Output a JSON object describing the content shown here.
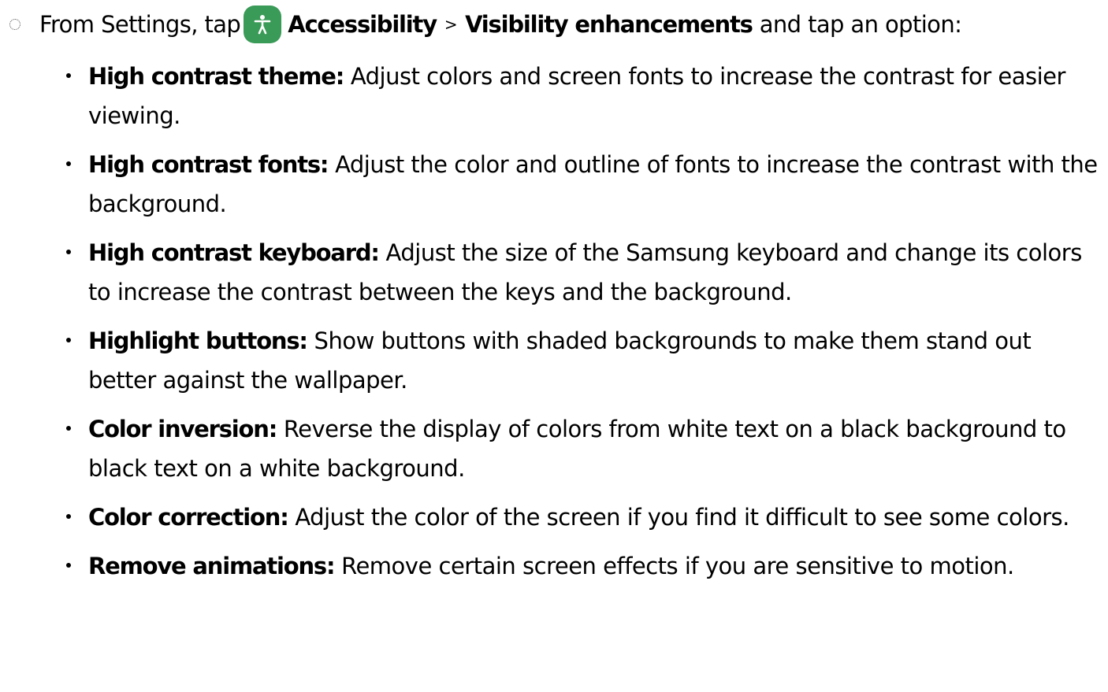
{
  "step": {
    "prefix": "From Settings, tap",
    "icon": "accessibility-icon",
    "icon_color": "#3a9a57",
    "menu1": "Accessibility",
    "separator": ">",
    "menu2": "Visibility enhancements",
    "suffix": "and tap an option:"
  },
  "options": [
    {
      "term": "High contrast theme:",
      "desc": "Adjust colors and screen fonts to increase the contrast for easier viewing."
    },
    {
      "term": "High contrast fonts:",
      "desc": "Adjust the color and outline of fonts to increase the contrast with the background."
    },
    {
      "term": "High contrast keyboard:",
      "desc": "Adjust the size of the Samsung keyboard and change its colors to increase the contrast between the keys and the background."
    },
    {
      "term": "Highlight buttons:",
      "desc": "Show buttons with shaded backgrounds to make them stand out better against the wallpaper."
    },
    {
      "term": "Color inversion:",
      "desc": "Reverse the display of colors from white text on a black background to black text on a white background."
    },
    {
      "term": "Color correction:",
      "desc": "Adjust the color of the screen if you find it difficult to see some colors."
    },
    {
      "term": "Remove animations:",
      "desc": "Remove certain screen effects if you are sensitive to motion."
    }
  ]
}
